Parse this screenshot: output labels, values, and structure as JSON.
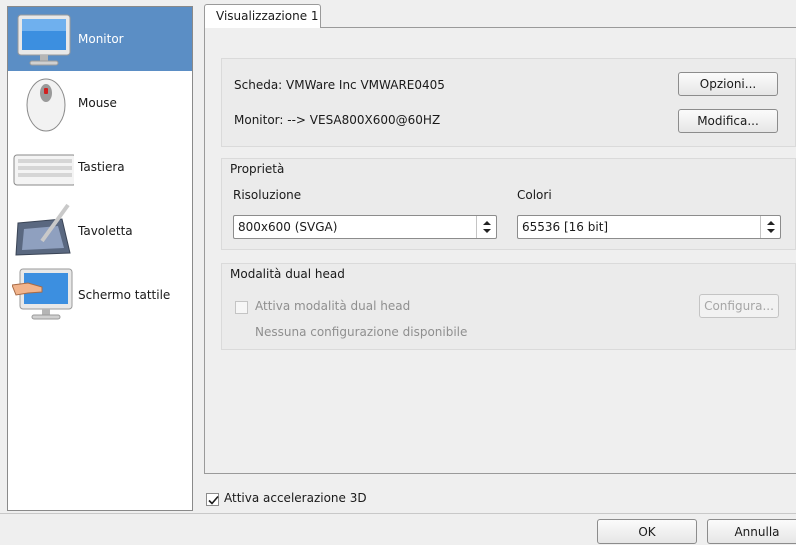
{
  "sidebar": {
    "items": [
      {
        "label": "Monitor",
        "icon": "monitor-icon",
        "selected": true
      },
      {
        "label": "Mouse",
        "icon": "mouse-icon",
        "selected": false
      },
      {
        "label": "Tastiera",
        "icon": "keyboard-icon",
        "selected": false
      },
      {
        "label": "Tavoletta",
        "icon": "tablet-icon",
        "selected": false
      },
      {
        "label": "Schermo tattile",
        "icon": "touchscreen-icon",
        "selected": false
      }
    ]
  },
  "tabs": [
    {
      "label": "Visualizzazione 1",
      "active": true
    }
  ],
  "card": {
    "card_label": "Scheda: VMWare Inc VMWARE0405",
    "monitor_label": "Monitor: --> VESA800X600@60HZ",
    "options_button": "Opzioni...",
    "modify_button": "Modifica..."
  },
  "properties": {
    "title": "Proprietà",
    "resolution_label": "Risoluzione",
    "resolution_value": "800x600 (SVGA)",
    "colors_label": "Colori",
    "colors_value": "65536 [16 bit]"
  },
  "dualhead": {
    "title": "Modalità dual head",
    "checkbox_label": "Attiva modalità dual head",
    "checked": false,
    "status": "Nessuna configurazione disponibile",
    "configure_button": "Configura..."
  },
  "accel": {
    "checkbox_label": "Attiva accelerazione 3D",
    "checked": true
  },
  "footer": {
    "ok_button": "OK",
    "cancel_button": "Annulla"
  },
  "colors": {
    "selection": "#5b8ec5",
    "background": "#efefef"
  }
}
